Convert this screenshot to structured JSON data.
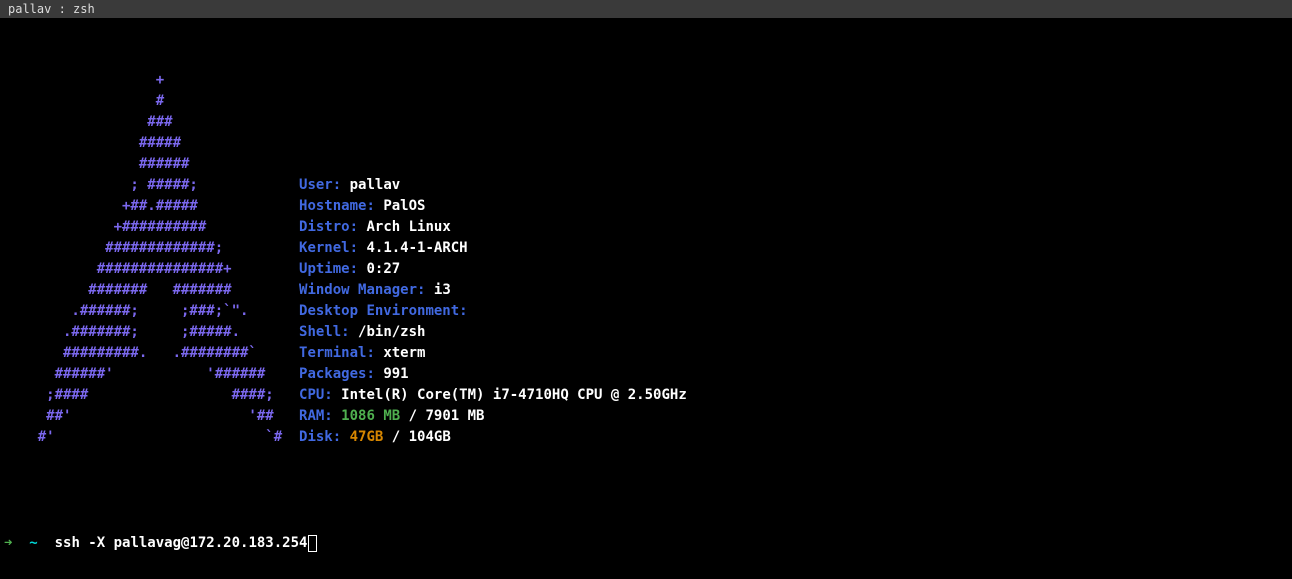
{
  "window_title": "pallav : zsh",
  "ascii_logo": [
    "                  +",
    "                  #",
    "                 ###",
    "                #####",
    "                ######",
    "               ; #####;",
    "              +##.#####",
    "             +##########",
    "            #############;",
    "           ###############+",
    "          #######   #######",
    "        .######;     ;###;`\".",
    "       .#######;     ;#####.",
    "       #########.   .########`",
    "      ######'           '######",
    "     ;####                 ####;",
    "     ##'                     '##",
    "    #'                         `#"
  ],
  "info": {
    "user_label": "User:",
    "user_value": "pallav",
    "hostname_label": "Hostname:",
    "hostname_value": "PalOS",
    "distro_label": "Distro:",
    "distro_value": "Arch Linux",
    "kernel_label": "Kernel:",
    "kernel_value": "4.1.4-1-ARCH",
    "uptime_label": "Uptime:",
    "uptime_value": "0:27",
    "wm_label": "Window Manager:",
    "wm_value": "i3",
    "de_label": "Desktop Environment:",
    "de_value": "",
    "shell_label": "Shell:",
    "shell_value": "/bin/zsh",
    "terminal_label": "Terminal:",
    "terminal_value": "xterm",
    "packages_label": "Packages:",
    "packages_value": "991",
    "cpu_label": "CPU:",
    "cpu_value": "Intel(R) Core(TM) i7-4710HQ CPU @ 2.50GHz",
    "ram_label": "RAM:",
    "ram_used": "1086 MB",
    "ram_sep": " / ",
    "ram_total": "7901 MB",
    "disk_label": "Disk:",
    "disk_used": "47GB",
    "disk_sep": " / ",
    "disk_total": "104GB"
  },
  "prompt": {
    "arrow": "➜",
    "cwd": "~",
    "command": "ssh -X pallavag@172.20.183.254"
  }
}
